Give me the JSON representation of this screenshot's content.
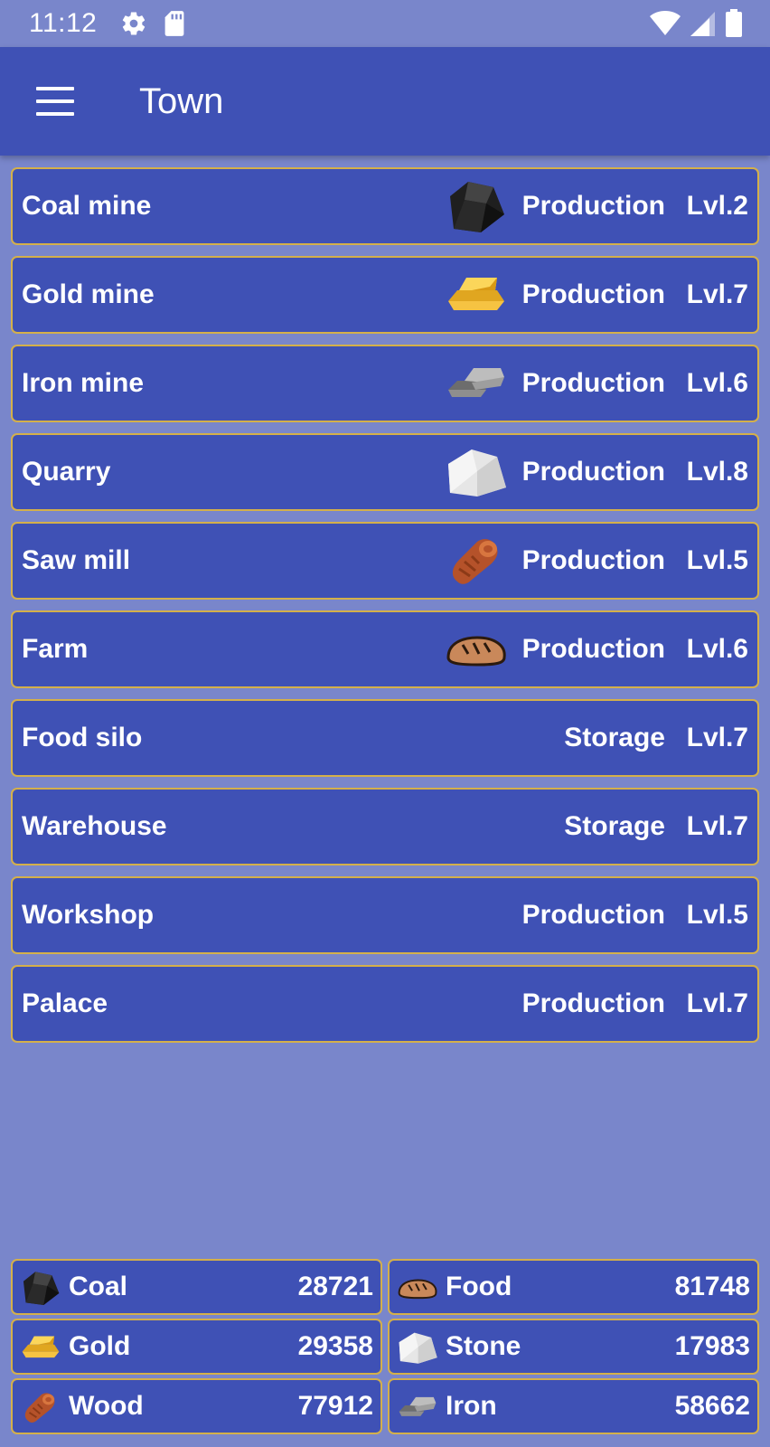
{
  "status_bar": {
    "time": "11:12"
  },
  "app_bar": {
    "title": "Town"
  },
  "buildings": [
    {
      "name": "Coal mine",
      "icon": "coal-icon",
      "type": "Production",
      "level": "Lvl.2"
    },
    {
      "name": "Gold mine",
      "icon": "gold-icon",
      "type": "Production",
      "level": "Lvl.7"
    },
    {
      "name": "Iron mine",
      "icon": "iron-icon",
      "type": "Production",
      "level": "Lvl.6"
    },
    {
      "name": "Quarry",
      "icon": "stone-icon",
      "type": "Production",
      "level": "Lvl.8"
    },
    {
      "name": "Saw mill",
      "icon": "wood-icon",
      "type": "Production",
      "level": "Lvl.5"
    },
    {
      "name": "Farm",
      "icon": "bread-icon",
      "type": "Production",
      "level": "Lvl.6"
    },
    {
      "name": "Food silo",
      "icon": "",
      "type": "Storage",
      "level": "Lvl.7"
    },
    {
      "name": "Warehouse",
      "icon": "",
      "type": "Storage",
      "level": "Lvl.7"
    },
    {
      "name": "Workshop",
      "icon": "",
      "type": "Production",
      "level": "Lvl.5"
    },
    {
      "name": "Palace",
      "icon": "",
      "type": "Production",
      "level": "Lvl.7"
    }
  ],
  "resources": [
    {
      "name": "Coal",
      "icon": "coal-icon",
      "value": "28721"
    },
    {
      "name": "Food",
      "icon": "bread-icon",
      "value": "81748"
    },
    {
      "name": "Gold",
      "icon": "gold-icon",
      "value": "29358"
    },
    {
      "name": "Stone",
      "icon": "stone-icon",
      "value": "17983"
    },
    {
      "name": "Wood",
      "icon": "wood-icon",
      "value": "77912"
    },
    {
      "name": "Iron",
      "icon": "iron-icon",
      "value": "58662"
    }
  ],
  "colors": {
    "background": "#7986cb",
    "app_bar": "#3f51b5",
    "card": "#3f51b5",
    "card_border": "#d4b04a"
  }
}
